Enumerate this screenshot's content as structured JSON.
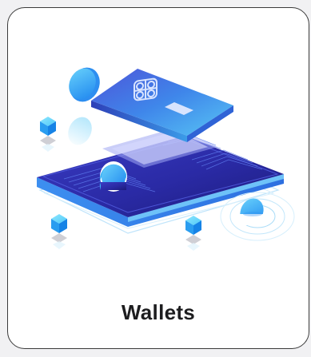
{
  "card": {
    "title": "Wallets",
    "illustration_icon": "crypto-wallet-illustration-icon"
  },
  "colors": {
    "page_background": "#f1f1f3",
    "card_background": "#ffffff",
    "card_border": "#3a3a3a",
    "title_text": "#1d1d1f",
    "accent_blue": "#1f8ef0",
    "deep_indigo": "#2b2a9a",
    "cyan": "#35b9f5"
  }
}
